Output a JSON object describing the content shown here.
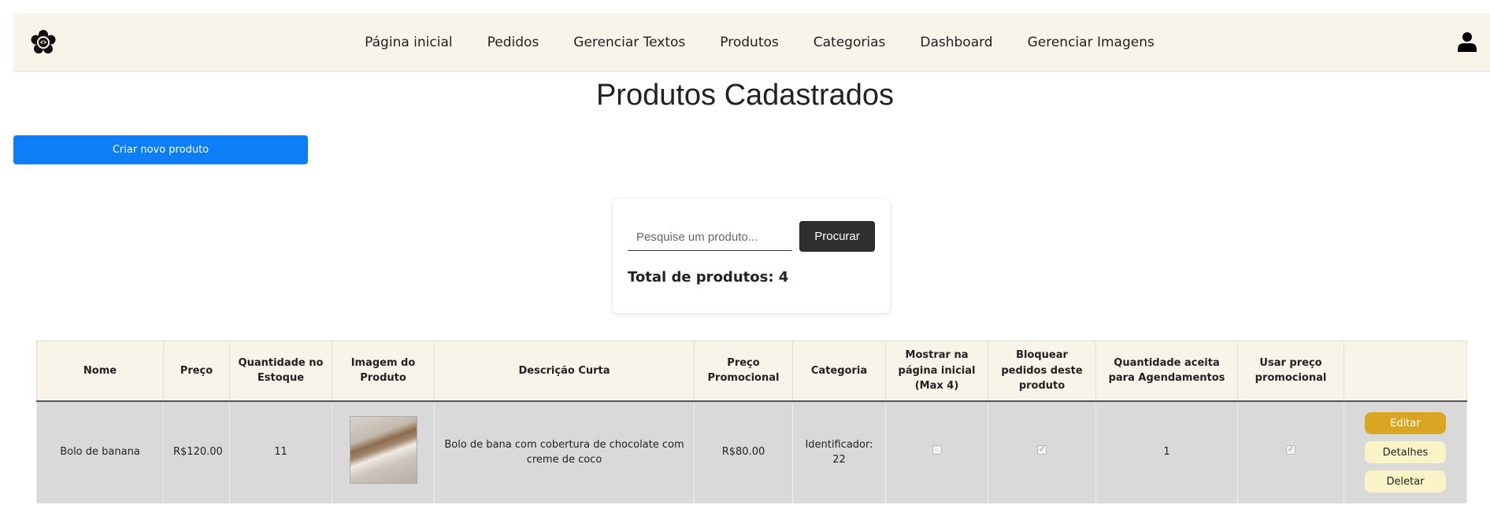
{
  "nav": {
    "links": [
      "Página inicial",
      "Pedidos",
      "Gerenciar Textos",
      "Produtos",
      "Categorias",
      "Dashboard",
      "Gerenciar Imagens"
    ]
  },
  "page_title": "Produtos Cadastrados",
  "create_button": "Criar novo produto",
  "search": {
    "placeholder": "Pesquise um produto...",
    "button": "Procurar",
    "total_label": "Total de produtos: 4"
  },
  "table": {
    "headers": [
      "Nome",
      "Preço",
      "Quantidade no Estoque",
      "Imagem do Produto",
      "Descrição Curta",
      "Preço Promocional",
      "Categoria",
      "Mostrar na página inicial (Max 4)",
      "Bloquear pedidos deste produto",
      "Quantidade aceita para Agendamentos",
      "Usar preço promocional",
      ""
    ],
    "rows": [
      {
        "name": "Bolo de banana",
        "price": "R$120.00",
        "stock": "11",
        "description": "Bolo de bana com cobertura de chocolate com creme de coco",
        "promo_price": "R$80.00",
        "category": "Identificador: 22",
        "show_home": false,
        "block_orders": true,
        "schedule_qty": "1",
        "use_promo": true,
        "actions": {
          "edit": "Editar",
          "details": "Detalhes",
          "delete": "Deletar"
        }
      }
    ]
  },
  "colors": {
    "navbar_bg": "#f8f4ea",
    "primary": "#0d7ef8",
    "edit": "#daa520",
    "row_bg": "#d9d9d9"
  }
}
